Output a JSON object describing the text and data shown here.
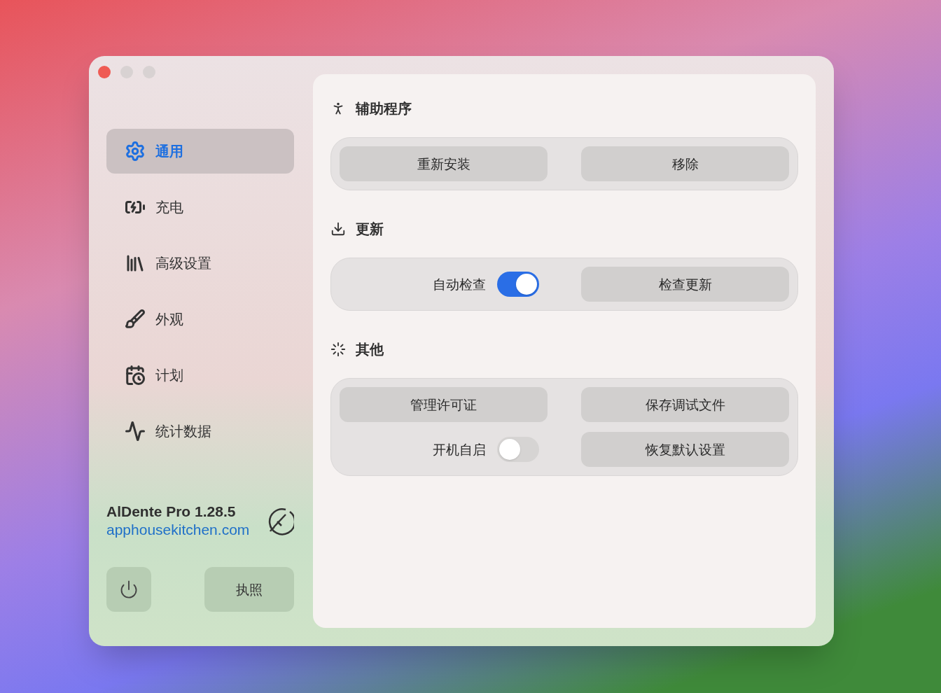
{
  "sidebar": {
    "items": [
      {
        "label": "通用",
        "selected": true
      },
      {
        "label": "充电",
        "selected": false
      },
      {
        "label": "高级设置",
        "selected": false
      },
      {
        "label": "外观",
        "selected": false
      },
      {
        "label": "计划",
        "selected": false
      },
      {
        "label": "统计数据",
        "selected": false
      }
    ],
    "app_name": "AlDente Pro 1.28.5",
    "link": "apphousekitchen.com",
    "license_button": "执照"
  },
  "sections": [
    {
      "title": "辅助程序",
      "items": [
        {
          "kind": "button",
          "label": "重新安装"
        },
        {
          "kind": "button",
          "label": "移除"
        }
      ]
    },
    {
      "title": "更新",
      "items": [
        {
          "kind": "toggle",
          "label": "自动检查",
          "on": true
        },
        {
          "kind": "button",
          "label": "检查更新"
        }
      ]
    },
    {
      "title": "其他",
      "items": [
        {
          "kind": "button",
          "label": "管理许可证"
        },
        {
          "kind": "button",
          "label": "保存调试文件"
        },
        {
          "kind": "toggle",
          "label": "开机自启",
          "on": false
        },
        {
          "kind": "button",
          "label": "恢复默认设置"
        }
      ]
    }
  ]
}
